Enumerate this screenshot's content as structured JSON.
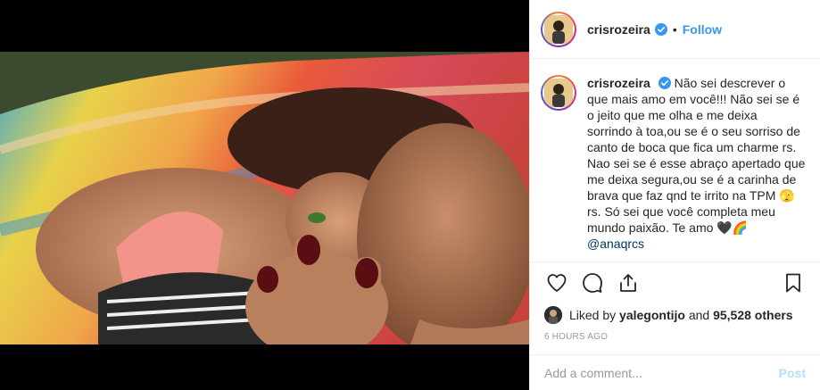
{
  "header": {
    "username": "crisrozeira",
    "separator": "•",
    "follow_label": "Follow"
  },
  "caption": {
    "username": "crisrozeira",
    "text": "Não sei descrever o que mais amo em você!!! Não sei se é o jeito que me olha e me deixa sorrindo à toa,ou se é o seu sorriso de canto de boca que fica um charme rs. Nao sei se é esse abraço apertado que me deixa segura,ou se é a carinha de brava que faz qnd te irrito na TPM 🫣 rs. Só sei que você completa meu mundo paixão. Te amo 🖤🌈",
    "mention": "@anaqrcs"
  },
  "likes": {
    "prefix": "Liked by",
    "user": "yalegontijo",
    "middle": "and",
    "count": "95,528 others"
  },
  "timestamp": "6 HOURS AGO",
  "comment_box": {
    "placeholder": "Add a comment...",
    "post_label": "Post"
  },
  "icons": {
    "verified": "verified-badge-icon",
    "like": "heart-icon",
    "comment": "comment-bubble-icon",
    "share": "share-icon",
    "save": "bookmark-icon"
  },
  "colors": {
    "link": "#3897f0",
    "verified": "#3897f0",
    "post_disabled": "#b2dffc",
    "muted": "#999999"
  }
}
